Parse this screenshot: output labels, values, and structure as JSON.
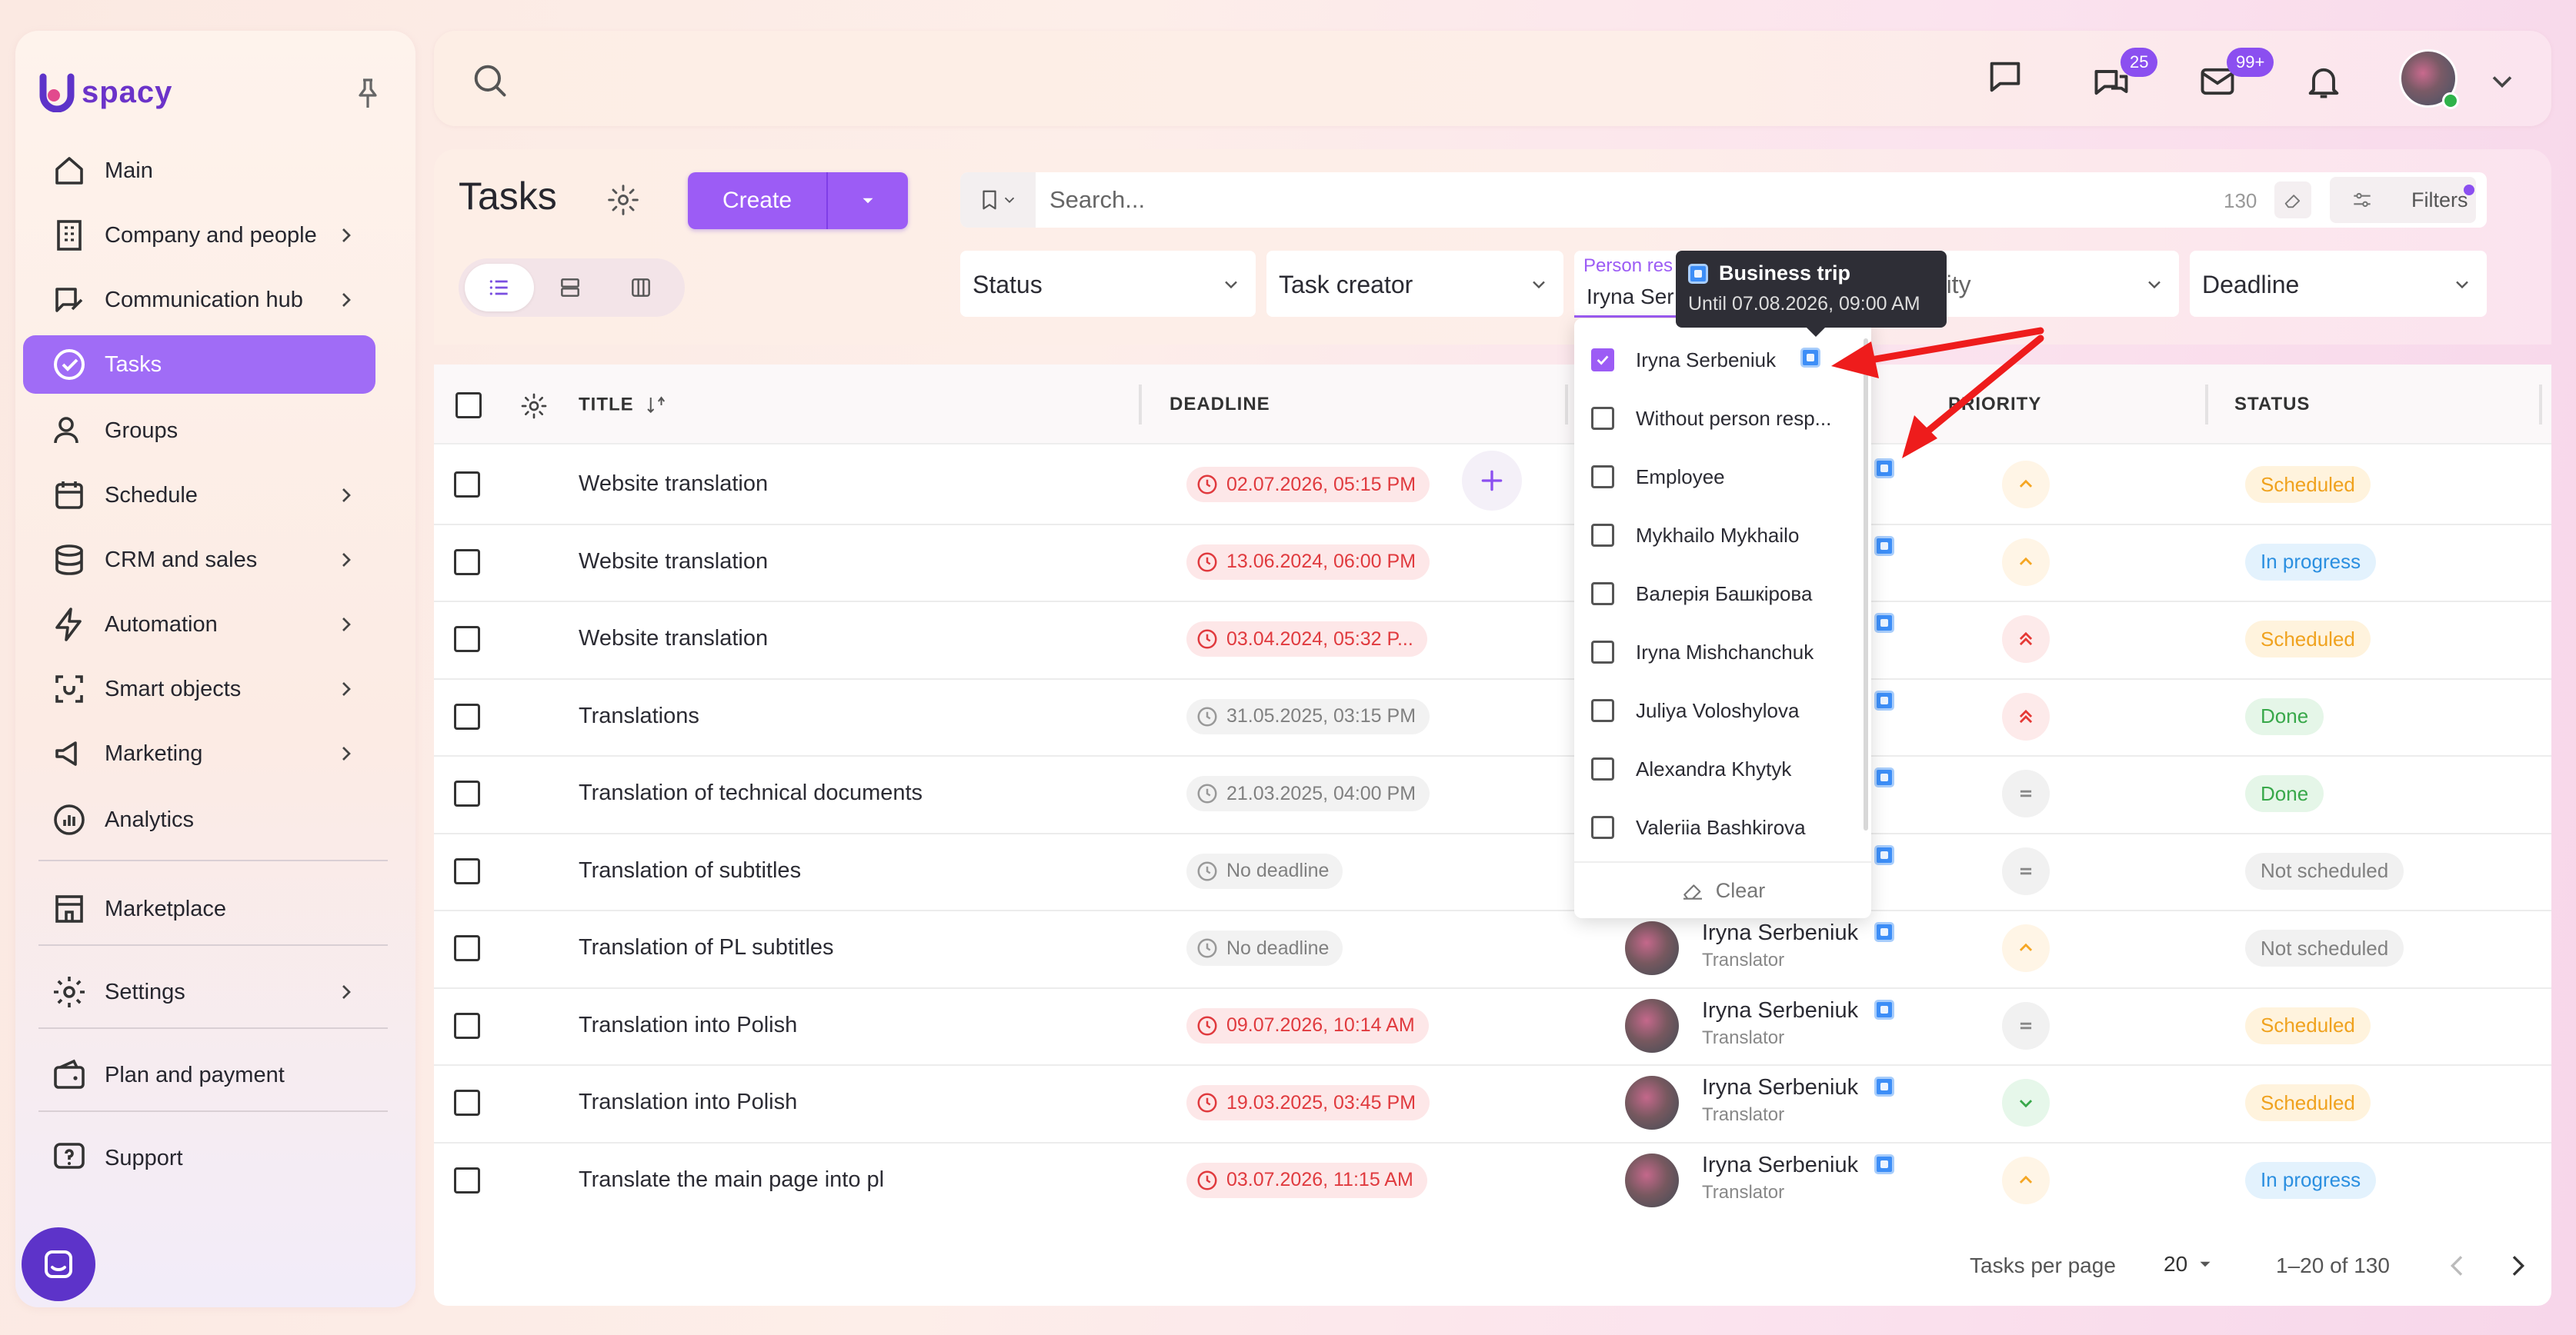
{
  "app": {
    "logo_text": "spacy"
  },
  "sidebar": {
    "items": [
      {
        "label": "Main",
        "icon": "home-icon"
      },
      {
        "label": "Company and people",
        "icon": "building-icon"
      },
      {
        "label": "Communication hub",
        "icon": "chat-edit-icon"
      },
      {
        "label": "Tasks",
        "icon": "check-circle-icon",
        "active": true
      },
      {
        "label": "Groups",
        "icon": "users-icon"
      },
      {
        "label": "Schedule",
        "icon": "calendar-icon"
      },
      {
        "label": "CRM and sales",
        "icon": "coins-icon"
      },
      {
        "label": "Automation",
        "icon": "bolt-icon"
      },
      {
        "label": "Smart objects",
        "icon": "scan-icon"
      },
      {
        "label": "Marketing",
        "icon": "megaphone-icon"
      },
      {
        "label": "Analytics",
        "icon": "chart-icon"
      },
      {
        "label": "Marketplace",
        "icon": "store-icon"
      },
      {
        "label": "Settings",
        "icon": "gear-icon"
      },
      {
        "label": "Plan and payment",
        "icon": "wallet-icon"
      },
      {
        "label": "Support",
        "icon": "help-icon"
      }
    ]
  },
  "topbar": {
    "chat_badge": "25",
    "mail_badge": "99+"
  },
  "page": {
    "title": "Tasks",
    "create_label": "Create",
    "search_placeholder": "Search...",
    "search_count": "130",
    "filters_label": "Filters"
  },
  "filters": {
    "status": "Status",
    "task_creator": "Task creator",
    "person_label": "Person res",
    "person_value": "Iryna Ser",
    "priority": "Priority",
    "deadline": "Deadline"
  },
  "tooltip": {
    "title": "Business trip",
    "subtitle": "Until 07.08.2026, 09:00 AM"
  },
  "dropdown": {
    "options": [
      {
        "label": "Iryna Serbeniuk",
        "checked": true
      },
      {
        "label": "Without person resp...",
        "checked": false
      },
      {
        "label": "Employee",
        "checked": false
      },
      {
        "label": "Mykhailo Mykhailo",
        "checked": false
      },
      {
        "label": "Валерія Башкірова",
        "checked": false
      },
      {
        "label": "Iryna Mishchanchuk",
        "checked": false
      },
      {
        "label": "Juliya Voloshylova",
        "checked": false
      },
      {
        "label": "Alexandra Khytyk",
        "checked": false
      },
      {
        "label": "Valeriia Bashkirova",
        "checked": false
      }
    ],
    "clear_label": "Clear"
  },
  "table": {
    "headers": {
      "title": "TITLE",
      "deadline": "DEADLINE",
      "priority": "PRIORITY",
      "status": "STATUS"
    },
    "rows": [
      {
        "title": "Website translation",
        "deadline": "02.07.2026, 05:15 PM",
        "deadline_type": "red",
        "priority": "up",
        "status": "Scheduled",
        "person": "",
        "role": ""
      },
      {
        "title": "Website translation",
        "deadline": "13.06.2024, 06:00 PM",
        "deadline_type": "red",
        "priority": "up",
        "status": "In progress",
        "person": "",
        "role": ""
      },
      {
        "title": "Website translation",
        "deadline": "03.04.2024, 05:32 P...",
        "deadline_type": "red",
        "priority": "double-up",
        "status": "Scheduled",
        "person": "",
        "role": ""
      },
      {
        "title": "Translations",
        "deadline": "31.05.2025, 03:15 PM",
        "deadline_type": "grey",
        "priority": "double-up",
        "status": "Done",
        "person": "",
        "role": ""
      },
      {
        "title": "Translation of technical documents",
        "deadline": "21.03.2025, 04:00 PM",
        "deadline_type": "grey",
        "priority": "equal",
        "status": "Done",
        "person": "",
        "role": ""
      },
      {
        "title": "Translation of subtitles",
        "deadline": "No deadline",
        "deadline_type": "grey",
        "priority": "equal",
        "status": "Not scheduled",
        "person": "",
        "role": ""
      },
      {
        "title": "Translation of PL subtitles",
        "deadline": "No deadline",
        "deadline_type": "grey",
        "priority": "up",
        "status": "Not scheduled",
        "person": "Iryna Serbeniuk",
        "role": "Translator"
      },
      {
        "title": "Translation into Polish",
        "deadline": "09.07.2026, 10:14 AM",
        "deadline_type": "red",
        "priority": "equal",
        "status": "Scheduled",
        "person": "Iryna Serbeniuk",
        "role": "Translator"
      },
      {
        "title": "Translation into Polish",
        "deadline": "19.03.2025, 03:45 PM",
        "deadline_type": "red",
        "priority": "down",
        "status": "Scheduled",
        "person": "Iryna Serbeniuk",
        "role": "Translator"
      },
      {
        "title": "Translate the main page into pl",
        "deadline": "03.07.2026, 11:15 AM",
        "deadline_type": "red",
        "priority": "up",
        "status": "In progress",
        "person": "Iryna Serbeniuk",
        "role": "Translator"
      }
    ]
  },
  "footer": {
    "per_page_label": "Tasks per page",
    "per_page_value": "20",
    "range": "1–20 of 130"
  },
  "colors": {
    "accent": "#9c5cf5",
    "brand": "#5d33c9",
    "danger": "#e03a3e"
  }
}
